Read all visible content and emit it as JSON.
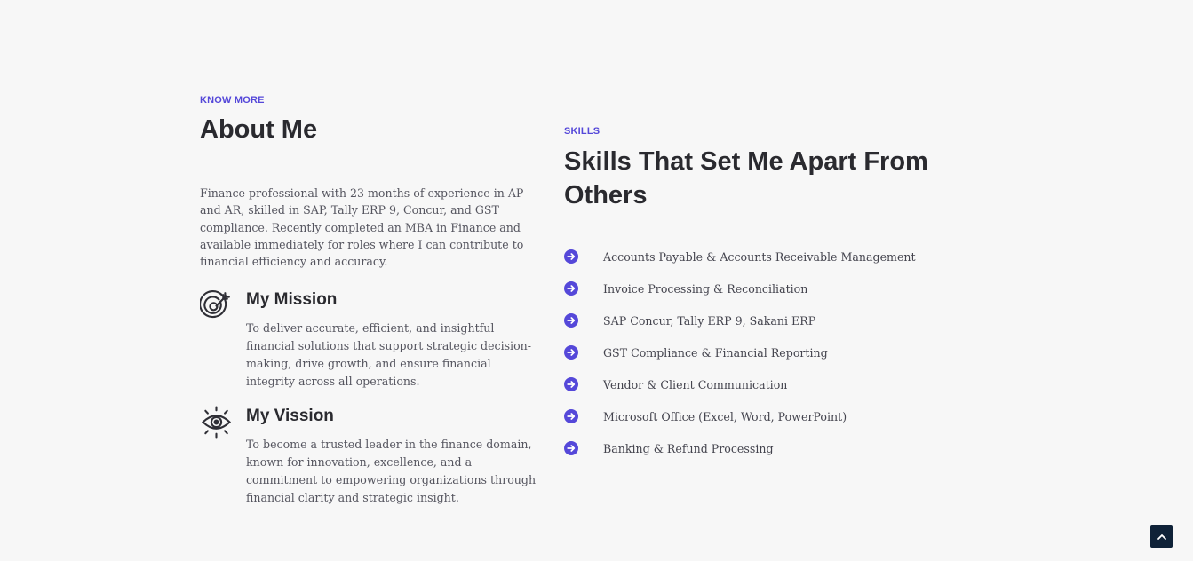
{
  "about": {
    "eyebrow": "KNOW MORE",
    "title": "About Me",
    "description": "Finance professional with 23 months of experience in AP and AR, skilled in SAP, Tally ERP 9, Concur, and GST compliance. Recently completed an MBA in Finance and available immediately for roles where I can contribute to financial efficiency and accuracy.",
    "mission": {
      "icon": "target-icon",
      "title": "My Mission",
      "text": "To deliver accurate, efficient, and insightful financial solutions that support strategic decision-making, drive growth, and ensure financial integrity across all operations."
    },
    "vision": {
      "icon": "eye-icon",
      "title": "My Vission",
      "text": "To become a trusted leader in the finance domain, known for innovation, excellence, and a commitment to empowering organizations through financial clarity and strategic insight."
    }
  },
  "skills": {
    "eyebrow": "SKILLS",
    "title": "Skills That Set Me Apart From Others",
    "bullet_icon": "arrow-right-circle-icon",
    "items": [
      "Accounts Payable & Accounts Receivable Management",
      "Invoice Processing & Reconciliation",
      "SAP Concur, Tally ERP 9, Sakani ERP",
      "GST Compliance & Financial Reporting",
      "Vendor & Client Communication",
      "Microsoft Office (Excel, Word, PowerPoint)",
      "Banking & Refund Processing"
    ]
  },
  "back_to_top": {
    "icon": "chevron-up-icon"
  },
  "colors": {
    "background": "#f7f7f7",
    "accent": "#5548d9",
    "heading": "#2a2a2f",
    "body_text": "#55555f",
    "back_to_top_bg": "#0f2238"
  }
}
